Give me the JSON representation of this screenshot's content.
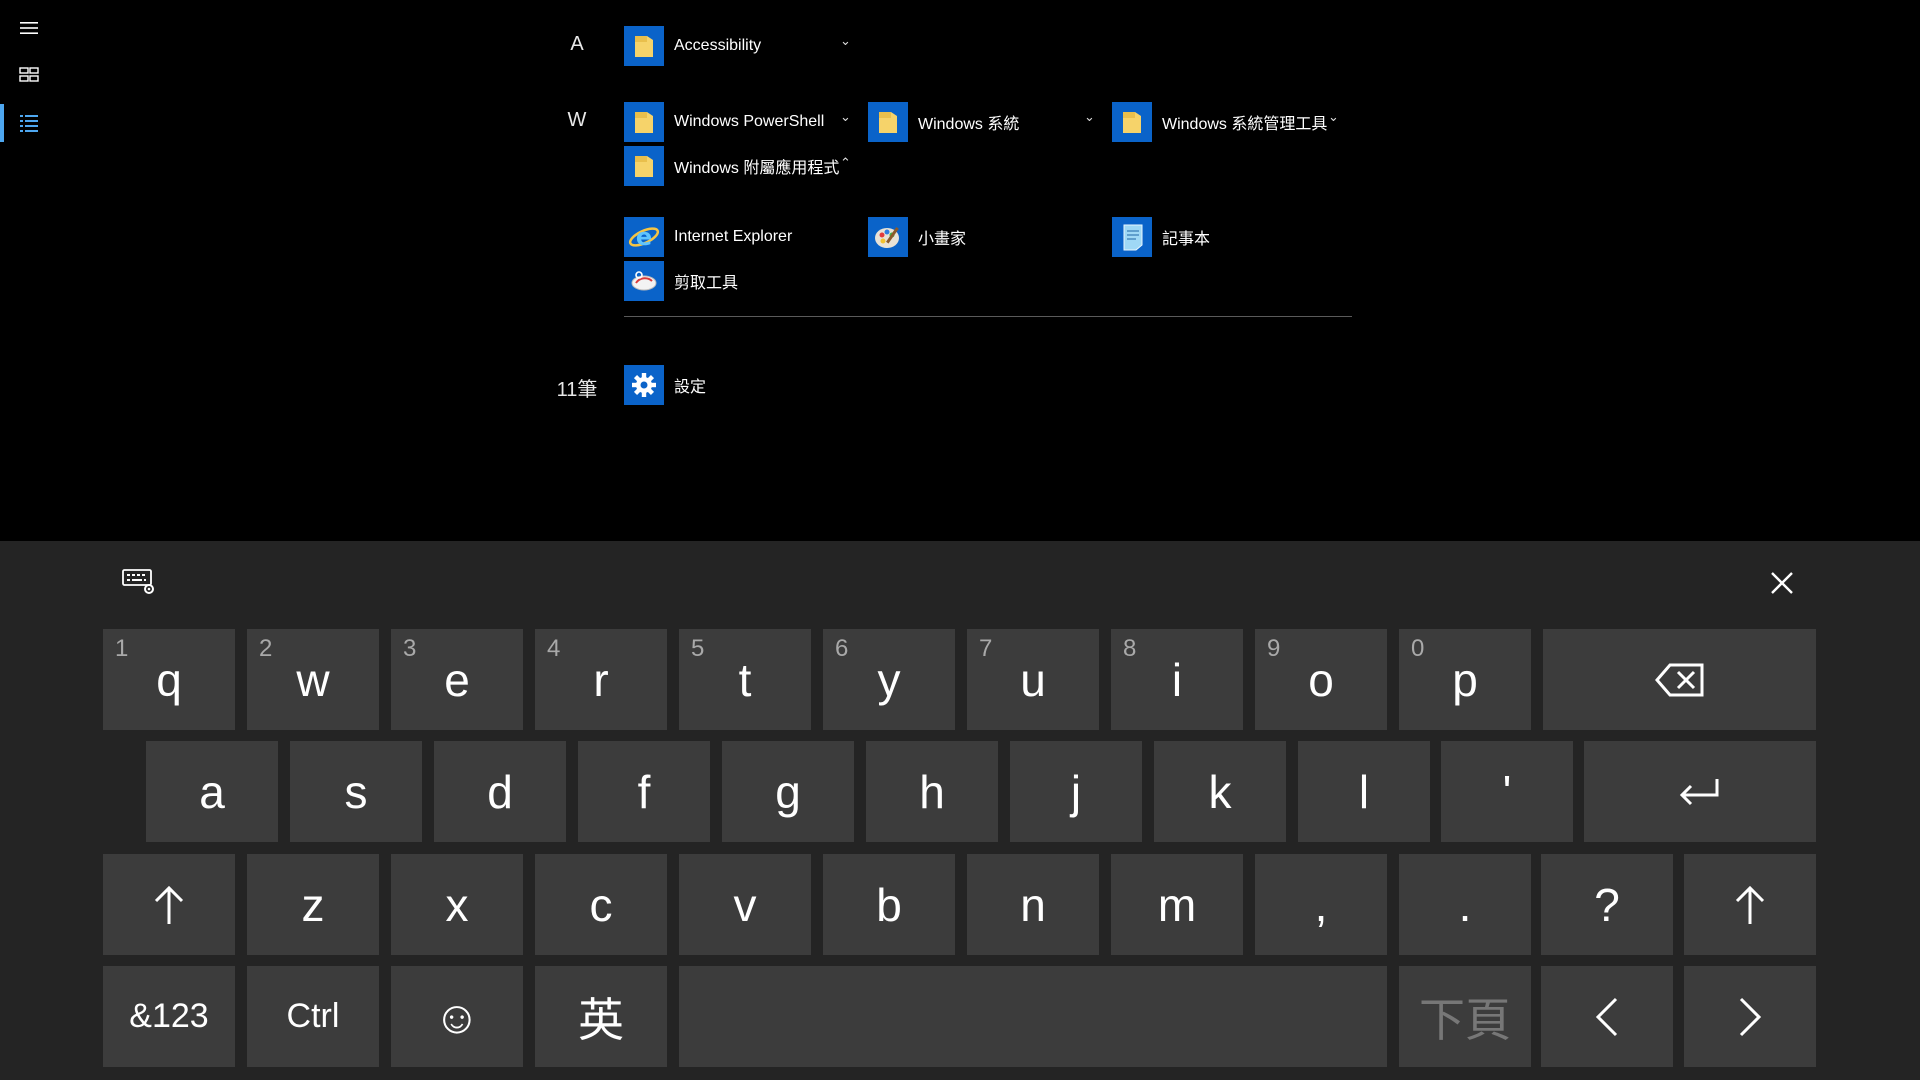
{
  "sections": [
    {
      "letter": "A",
      "apps": [
        {
          "name": "Accessibility",
          "icon": "folder-icon",
          "chevron": "down"
        }
      ]
    },
    {
      "letter": "W",
      "apps": [
        {
          "name": "Windows PowerShell",
          "icon": "folder-icon",
          "chevron": "down"
        },
        {
          "name": "Windows 系統",
          "icon": "folder-icon",
          "chevron": "down"
        },
        {
          "name": "Windows 系統管理工具",
          "icon": "folder-icon",
          "chevron": "down"
        },
        {
          "name": "Windows 附屬應用程式",
          "icon": "folder-icon",
          "chevron": "up"
        }
      ]
    },
    {
      "sub_apps": [
        {
          "name": "Internet Explorer",
          "icon": "internet-explorer-icon"
        },
        {
          "name": "小畫家",
          "icon": "paint-icon"
        },
        {
          "name": "記事本",
          "icon": "notepad-icon"
        },
        {
          "name": "剪取工具",
          "icon": "snipping-tool-icon"
        }
      ]
    },
    {
      "letter": "11筆",
      "apps": [
        {
          "name": "設定",
          "icon": "settings-gear-icon"
        }
      ]
    }
  ],
  "chevrons": {
    "down": "⌄",
    "up": "⌃"
  },
  "keyboard": {
    "row1": [
      {
        "label": "q",
        "num": "1"
      },
      {
        "label": "w",
        "num": "2"
      },
      {
        "label": "e",
        "num": "3"
      },
      {
        "label": "r",
        "num": "4"
      },
      {
        "label": "t",
        "num": "5"
      },
      {
        "label": "y",
        "num": "6"
      },
      {
        "label": "u",
        "num": "7"
      },
      {
        "label": "i",
        "num": "8"
      },
      {
        "label": "o",
        "num": "9"
      },
      {
        "label": "p",
        "num": "0"
      }
    ],
    "row2": [
      "a",
      "s",
      "d",
      "f",
      "g",
      "h",
      "j",
      "k",
      "l",
      "'"
    ],
    "row3": [
      "z",
      "x",
      "c",
      "v",
      "b",
      "n",
      "m",
      ",",
      ".",
      "?"
    ],
    "row4": {
      "symbols": "&123",
      "ctrl": "Ctrl",
      "emoji": "☺",
      "lang": "英",
      "next_page": "下頁"
    },
    "icons": {
      "backspace": "backspace-icon",
      "enter": "enter-icon",
      "shift": "shift-arrow-up-icon",
      "left": "chevron-left-icon",
      "right": "chevron-right-icon",
      "settings": "keyboard-settings-icon",
      "close": "close-icon"
    }
  },
  "colors": {
    "accent": "#0a63c9",
    "selection": "#4ea7f0",
    "key": "#3c3c3c",
    "keyboard_bg": "#242424"
  }
}
